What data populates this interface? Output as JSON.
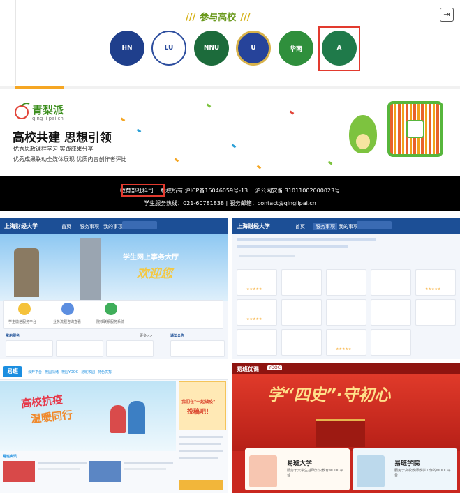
{
  "participating": {
    "title": "参与高校",
    "logos": [
      {
        "name": "HN",
        "color": "#1f3f8c"
      },
      {
        "name": "LU",
        "color": "#2c4d9e"
      },
      {
        "name": "NNU",
        "color": "#1c6b3b"
      },
      {
        "name": "U",
        "color": "#26439a"
      },
      {
        "name": "华南",
        "color": "#2f8f3c"
      },
      {
        "name": "A",
        "color": "#1f7a4a"
      }
    ]
  },
  "qinglipai": {
    "name": "青梨派",
    "domain": "qing li pai.cn",
    "headline": "高校共建 思想引领",
    "line1": "优秀思政课程学习 实践成果分享",
    "line2": "优秀成果联动全媒体展现 优质内容创作者评比"
  },
  "footer": {
    "line1": "教育部社科司    版权所有 沪ICP备15046059号-13    沪公网安备 31011002000023号",
    "line2": "学生服务热线：021-60781838 | 服务邮箱：contact@qinglipai.cn"
  },
  "shots": {
    "a": {
      "school": "上海财经大学",
      "nav": [
        "首页",
        "服务事项",
        "我的事项"
      ],
      "banner": "学生网上事务大厅",
      "welcome": "欢迎您",
      "icons": [
        "学生微信服务平台",
        "业务流程咨询查看",
        "院校联系服务系统"
      ],
      "section1": "常用服务",
      "section2": "通知公告",
      "more": "更多>>"
    },
    "b": {
      "school": "上海财经大学",
      "nav": [
        "首页",
        "服务事项",
        "我的事项"
      ]
    },
    "c": {
      "brand": "易班",
      "nav": [
        "云开平台",
        "校园情绪",
        "校园YOOC",
        "易班校园",
        "特色优秀"
      ],
      "banner1": "高校抗疫",
      "banner2": "温暖同行",
      "side_title": "我们在\"一起战疫\"",
      "side_sub": "投稿吧！",
      "news_title": "易班资讯"
    },
    "d": {
      "brand": "易班优课",
      "tag": "YOOC",
      "banner": "学“四史”·守初心",
      "card1_title": "易班大学",
      "card1_sub": "服务于大学生基础知识教育MOOC平台",
      "card2_title": "易班学院",
      "card2_sub": "服务于高校教师教学工作的MOOC平台"
    }
  }
}
